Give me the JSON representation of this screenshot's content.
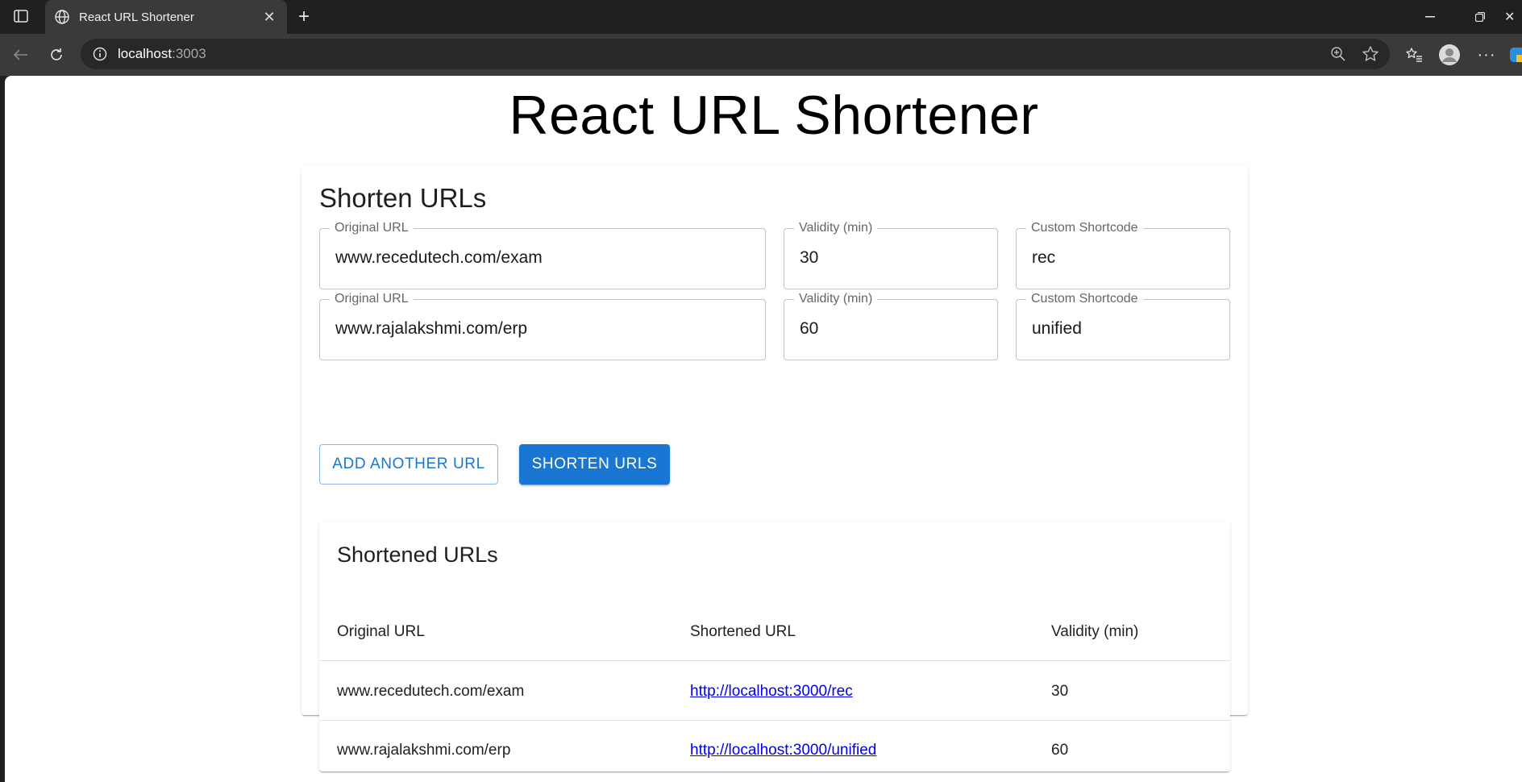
{
  "browser": {
    "tab_title": "React URL Shortener",
    "url_host": "localhost",
    "url_port": ":3003"
  },
  "page": {
    "title": "React URL Shortener"
  },
  "form": {
    "heading": "Shorten URLs",
    "rows": [
      {
        "original_url_label": "Original URL",
        "original_url_value": "www.recedutech.com/exam",
        "validity_label": "Validity (min)",
        "validity_value": "30",
        "shortcode_label": "Custom Shortcode",
        "shortcode_value": "rec"
      },
      {
        "original_url_label": "Original URL",
        "original_url_value": "www.rajalakshmi.com/erp",
        "validity_label": "Validity (min)",
        "validity_value": "60",
        "shortcode_label": "Custom Shortcode",
        "shortcode_value": "unified"
      }
    ],
    "add_button": "ADD ANOTHER URL",
    "submit_button": "SHORTEN URLS"
  },
  "results": {
    "heading": "Shortened URLs",
    "columns": [
      "Original URL",
      "Shortened URL",
      "Validity (min)"
    ],
    "rows": [
      {
        "original": "www.recedutech.com/exam",
        "short": "http://localhost:3000/rec",
        "validity": "30"
      },
      {
        "original": "www.rajalakshmi.com/erp",
        "short": "http://localhost:3000/unified",
        "validity": "60"
      }
    ]
  },
  "colors": {
    "primary": "#1976d2",
    "link": "#0000ee"
  }
}
